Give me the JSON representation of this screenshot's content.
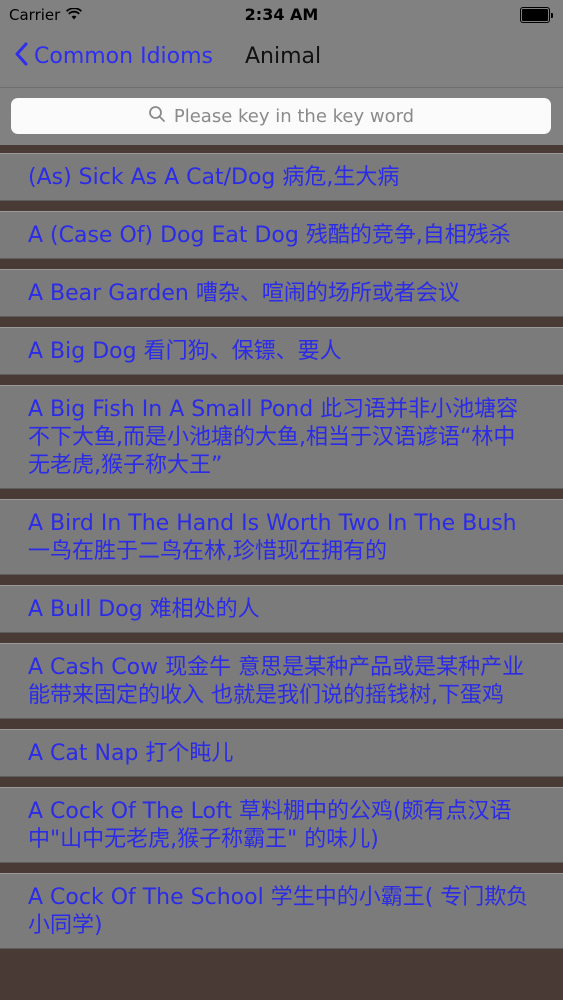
{
  "status_bar": {
    "carrier": "Carrier",
    "time": "2:34 AM",
    "battery_level": 1.0
  },
  "nav": {
    "back_label": "Common Idioms",
    "title": "Animal"
  },
  "search": {
    "placeholder": "Please key in the key word"
  },
  "idioms": [
    "(As) Sick As A Cat/Dog  病危,生大病",
    "A (Case Of) Dog Eat Dog  残酷的竞争,自相残杀",
    "A Bear Garden 嘈杂、喧闹的场所或者会议",
    "A Big Dog 看门狗、保镖、要人",
    "A Big Fish In A Small Pond  此习语并非小池塘容不下大鱼,而是小池塘的大鱼,相当于汉语谚语“林中无老虎,猴子称大王”",
    "A Bird In The Hand Is Worth Two In The Bush 一鸟在胜于二鸟在林,珍惜现在拥有的",
    "A Bull Dog 难相处的人",
    "A Cash Cow 现金牛 意思是某种产品或是某种产业能带来固定的收入 也就是我们说的摇钱树,下蛋鸡",
    "A Cat Nap 打个盹儿",
    "A Cock Of The Loft 草料棚中的公鸡(颇有点汉语中\"山中无老虎,猴子称霸王\" 的味儿)",
    "A Cock Of The School 学生中的小霸王( 专门欺负小同学)"
  ]
}
